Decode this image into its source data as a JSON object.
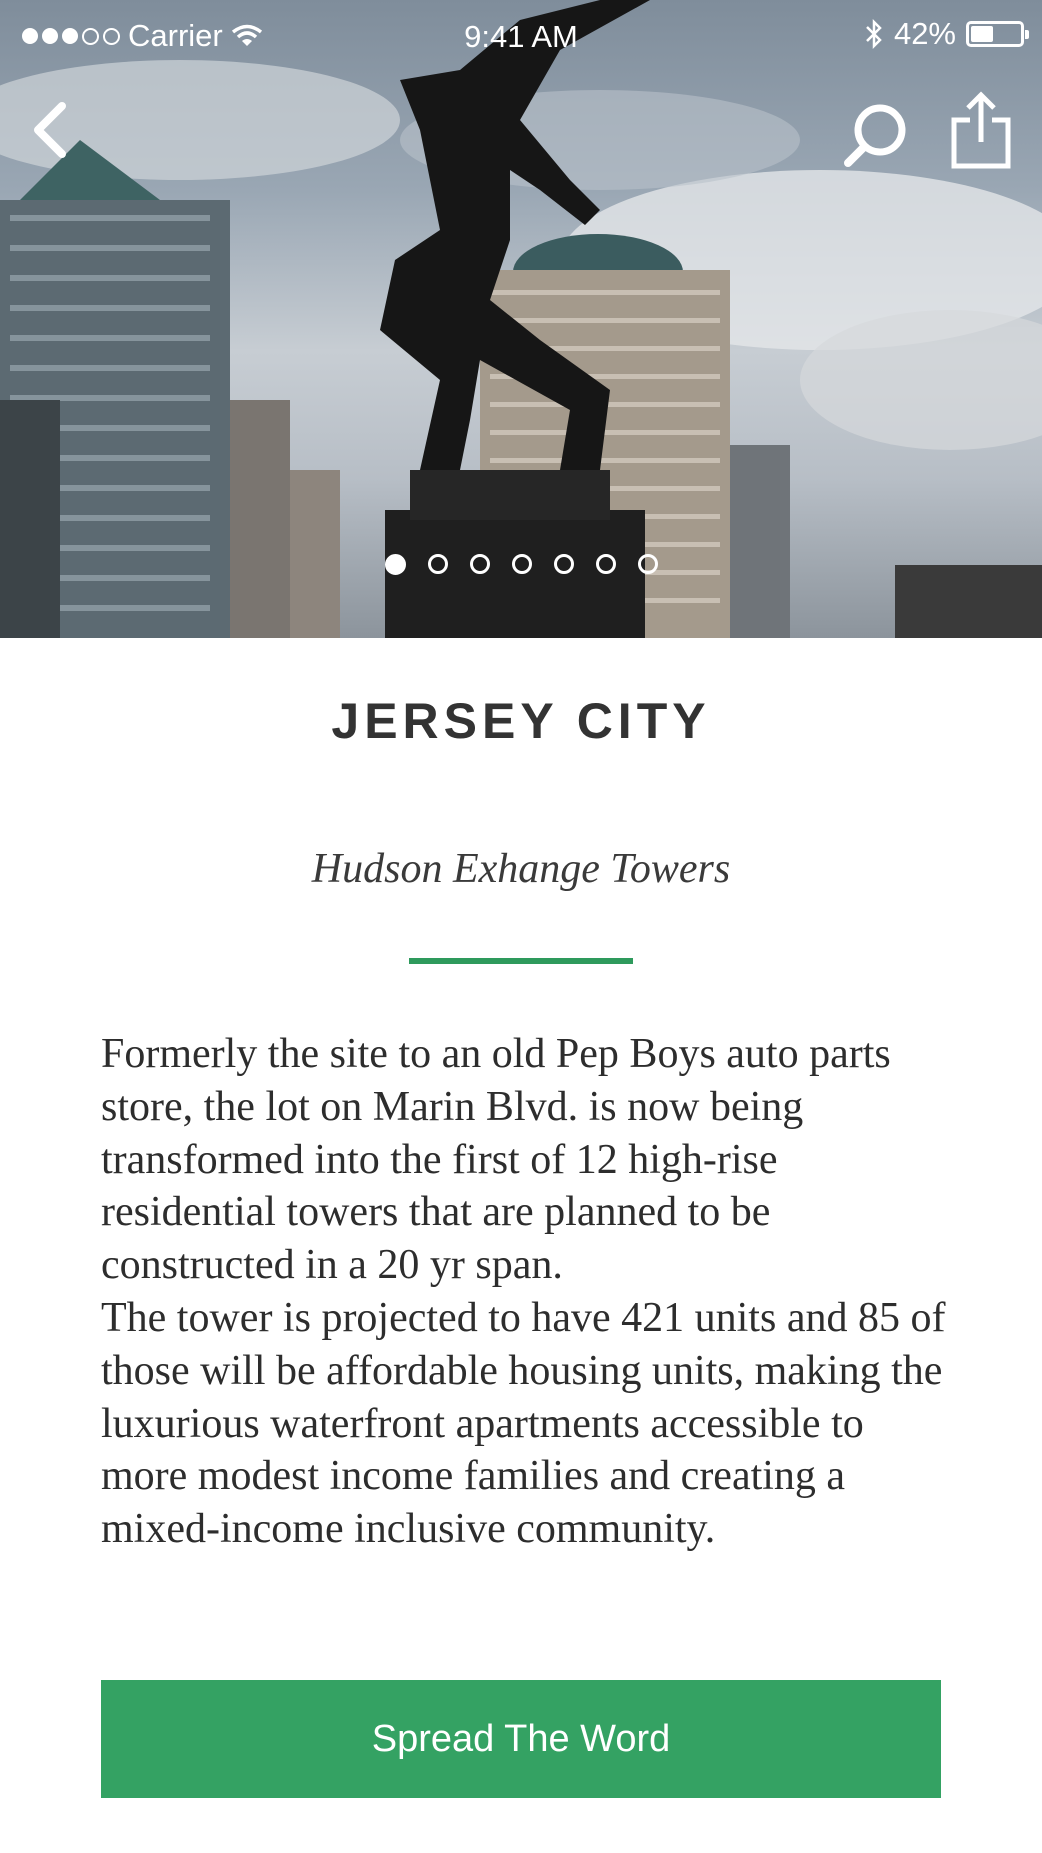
{
  "status_bar": {
    "carrier": "Carrier",
    "time": "9:41 AM",
    "battery": "42%",
    "battery_level": 0.42
  },
  "nav": {
    "back_icon": "chevron-left-icon",
    "search_icon": "search-icon",
    "share_icon": "share-icon"
  },
  "hero": {
    "page_count": 7,
    "active_page": 1
  },
  "content": {
    "title": "JERSEY CITY",
    "subtitle": "Hudson Exhange Towers",
    "paragraph_1": "Formerly the site to an old Pep Boys auto parts store, the lot on Marin Blvd. is now being transformed into the first of 12 high-rise residential towers that are planned to be constructed in a 20 yr span.",
    "paragraph_2": "The tower is projected to have 421 units and 85 of those will be affordable housing units, making the luxurious waterfront apartments accessible to more modest income families and creating a mixed-income inclusive community.",
    "cta_label": "Spread The Word"
  },
  "colors": {
    "accent": "#34a263",
    "divider": "#2e9a5c",
    "title_text": "#333333"
  }
}
